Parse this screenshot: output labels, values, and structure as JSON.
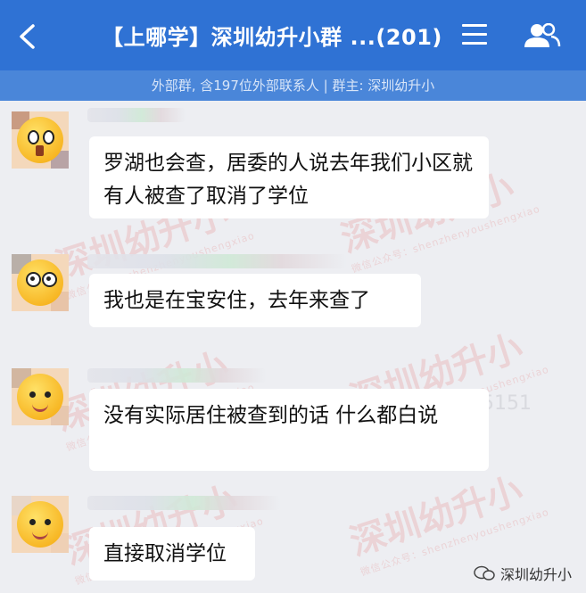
{
  "header": {
    "title": "【上哪学】深圳幼升小群 ...(201)",
    "subtitle": "外部群, 含197位外部联系人 | 群主: 深圳幼升小"
  },
  "messages": [
    {
      "text": "罗湖也会查，居委的人说去年我们小区就有人被查了取消了学位",
      "avatar": "face-wink-icon"
    },
    {
      "text": "我也是在宝安住，去年来查了",
      "avatar": "face-shy-icon"
    },
    {
      "text": "没有实际居住被查到的话 什么都白说",
      "avatar": "face-smile-icon"
    },
    {
      "text": "直接取消学位",
      "avatar": "face-smile-icon"
    }
  ],
  "watermark": {
    "text": "深圳幼升小",
    "sub": "微信公众号：shenzhenyoushengxiao",
    "num": "5151"
  },
  "footer_logo": "深圳幼升小",
  "colors": {
    "header": "#2f72d4",
    "subbar": "#4a86d9",
    "bg": "#edeef2"
  }
}
